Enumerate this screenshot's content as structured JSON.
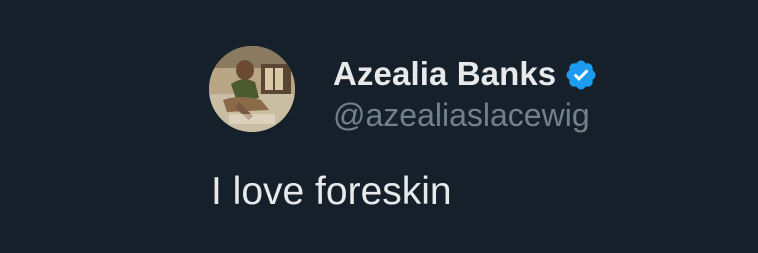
{
  "tweet": {
    "author": {
      "display_name": "Azealia Banks",
      "handle": "@azealiaslacewig",
      "verified": true,
      "verified_badge_color": "#1d9bf0"
    },
    "text": "I love foreskin"
  },
  "colors": {
    "background": "#16202b",
    "primary_text": "#e7e9ea",
    "secondary_text": "#71808c"
  },
  "icons": {
    "verified": "verified-badge-icon"
  }
}
